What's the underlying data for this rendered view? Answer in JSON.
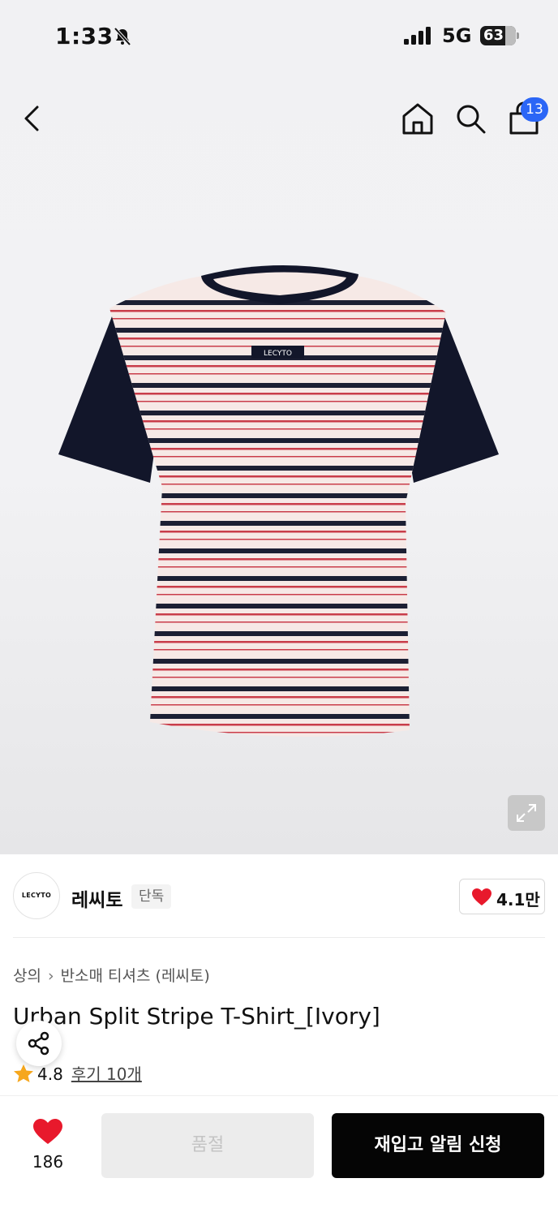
{
  "status_bar": {
    "time": "1:33",
    "network": "5G",
    "battery": "63"
  },
  "nav": {
    "cart_count": "13",
    "icons": [
      "back-arrow-icon",
      "home-icon",
      "search-icon",
      "shopping-bag-icon"
    ]
  },
  "product_image": {
    "shirt_label": "LECYTO",
    "neck_label": "LECYTO",
    "colors": {
      "body": "#f6e9e6",
      "stripe_dark": "#1c1f33",
      "stripe_red": "#c93d4a",
      "sleeve": "#12162a"
    }
  },
  "brand": {
    "logo_text": "LECYTO",
    "name": "레씨토",
    "tag": "단독",
    "likes": "4.1만"
  },
  "product": {
    "breadcrumb": [
      "상의",
      "반소매 티셔츠 (레씨토)"
    ],
    "title": "Urban Split Stripe T-Shirt_[Ivory]",
    "rating": "4.8",
    "reviews": "후기 10개"
  },
  "bottom_bar": {
    "wish_count": "186",
    "soldout_label": "품절",
    "restock_label": "재입고 알림 신청",
    "accent": "#e8192c"
  }
}
